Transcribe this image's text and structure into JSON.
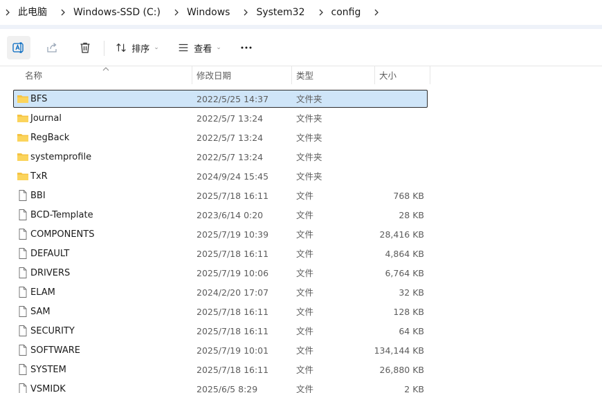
{
  "breadcrumb": [
    "此电脑",
    "Windows-SSD (C:)",
    "Windows",
    "System32",
    "config"
  ],
  "toolbar": {
    "rename_icon": "rename-icon",
    "share_icon": "share-icon",
    "delete_icon": "delete-icon",
    "sort_label": "排序",
    "view_label": "查看",
    "more_label": "..."
  },
  "columns": {
    "name": "名称",
    "modified": "修改日期",
    "type": "类型",
    "size": "大小"
  },
  "files": [
    {
      "name": "BFS",
      "modified": "2022/5/25 14:37",
      "type": "文件夹",
      "size": "",
      "icon": "folder-icon",
      "selected": true
    },
    {
      "name": "Journal",
      "modified": "2022/5/7 13:24",
      "type": "文件夹",
      "size": "",
      "icon": "folder-icon"
    },
    {
      "name": "RegBack",
      "modified": "2022/5/7 13:24",
      "type": "文件夹",
      "size": "",
      "icon": "folder-icon"
    },
    {
      "name": "systemprofile",
      "modified": "2022/5/7 13:24",
      "type": "文件夹",
      "size": "",
      "icon": "folder-icon"
    },
    {
      "name": "TxR",
      "modified": "2024/9/24 15:45",
      "type": "文件夹",
      "size": "",
      "icon": "folder-icon"
    },
    {
      "name": "BBI",
      "modified": "2025/7/18 16:11",
      "type": "文件",
      "size": "768 KB",
      "icon": "file-icon"
    },
    {
      "name": "BCD-Template",
      "modified": "2023/6/14 0:20",
      "type": "文件",
      "size": "28 KB",
      "icon": "file-icon"
    },
    {
      "name": "COMPONENTS",
      "modified": "2025/7/19 10:39",
      "type": "文件",
      "size": "28,416 KB",
      "icon": "file-icon"
    },
    {
      "name": "DEFAULT",
      "modified": "2025/7/18 16:11",
      "type": "文件",
      "size": "4,864 KB",
      "icon": "file-icon"
    },
    {
      "name": "DRIVERS",
      "modified": "2025/7/19 10:06",
      "type": "文件",
      "size": "6,764 KB",
      "icon": "file-icon"
    },
    {
      "name": "ELAM",
      "modified": "2024/2/20 17:07",
      "type": "文件",
      "size": "32 KB",
      "icon": "file-icon"
    },
    {
      "name": "SAM",
      "modified": "2025/7/18 16:11",
      "type": "文件",
      "size": "128 KB",
      "icon": "file-icon"
    },
    {
      "name": "SECURITY",
      "modified": "2025/7/18 16:11",
      "type": "文件",
      "size": "64 KB",
      "icon": "file-icon"
    },
    {
      "name": "SOFTWARE",
      "modified": "2025/7/19 10:01",
      "type": "文件",
      "size": "134,144 KB",
      "icon": "file-icon"
    },
    {
      "name": "SYSTEM",
      "modified": "2025/7/18 16:11",
      "type": "文件",
      "size": "26,880 KB",
      "icon": "file-icon"
    },
    {
      "name": "VSMIDK",
      "modified": "2025/6/5 8:29",
      "type": "文件",
      "size": "2 KB",
      "icon": "file-icon"
    }
  ],
  "colors": {
    "selection_bg": "#cfe5f8",
    "folder_yellow": "#f5c342",
    "accent": "#0067c0"
  }
}
